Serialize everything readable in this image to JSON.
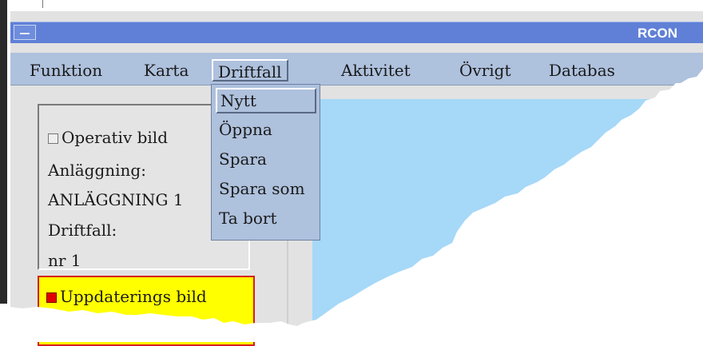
{
  "window": {
    "title": "RCON"
  },
  "menubar": {
    "items": [
      {
        "label": "Funktion",
        "active": false
      },
      {
        "label": "Karta",
        "active": false
      },
      {
        "label": "Driftfall",
        "active": true
      },
      {
        "label": "Aktivitet",
        "active": false
      },
      {
        "label": "Övrigt",
        "active": false
      },
      {
        "label": "Databas",
        "active": false
      }
    ]
  },
  "dropdown": {
    "items": [
      {
        "label": "Nytt",
        "selected": true
      },
      {
        "label": "Öppna",
        "selected": false
      },
      {
        "label": "Spara",
        "selected": false
      },
      {
        "label": "Spara som",
        "selected": false
      },
      {
        "label": "Ta bort",
        "selected": false
      }
    ]
  },
  "operative_panel": {
    "checkbox_label": "Operativ bild",
    "facility_label": "Anläggning:",
    "facility_value": "ANLÄGGNING 1",
    "case_label": "Driftfall:",
    "case_value": "nr 1"
  },
  "update_panel": {
    "checkbox_label": "Uppdaterings bild"
  },
  "colors": {
    "titlebar": "#5f80d6",
    "menubar": "#aec1dd",
    "map_water": "#a6d8f8",
    "update_panel": "#ffff00",
    "update_border": "#d61e1e"
  }
}
